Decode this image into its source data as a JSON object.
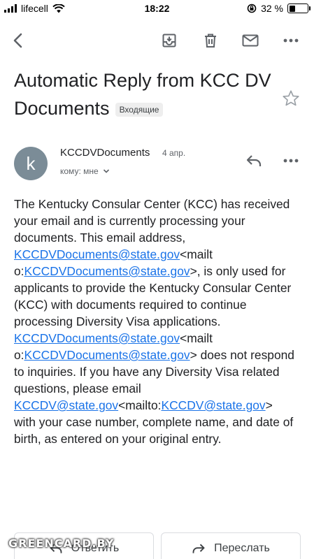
{
  "status_bar": {
    "carrier": "lifecell",
    "time": "18:22",
    "battery_percent": "32 %",
    "battery_level": 0.32
  },
  "toolbar": {
    "icons": [
      "back-icon",
      "archive-icon",
      "trash-icon",
      "mail-icon",
      "more-icon"
    ]
  },
  "email": {
    "subject": "Automatic Reply from KCC DV Documents",
    "label": "Входящие",
    "avatar_letter": "k",
    "avatar_color": "#7b8c97",
    "sender": "KCCDVDocuments",
    "date": "4 апр.",
    "recipient": "кому: мне",
    "body": {
      "p1": "The Kentucky Consular Center (KCC) has received your email and is currently processing your documents. This email address, ",
      "link1": "KCCDVDocuments@state.gov",
      "t1": "<mailt o:",
      "link2": "KCCDVDocuments@state.gov",
      "t2": ">, is only used for applicants to provide the Kentucky Consular Center (KCC) with documents required to continue processing Diversity Visa applications. ",
      "link3": "KCCDVDocuments@state.gov",
      "t3": "<mailt o:",
      "link4": "KCCDVDocuments@state.gov",
      "t4": "> does not respond to inquiries. If you have any Diversity Visa related questions, please email ",
      "link5": "KCCDV@state.gov",
      "t5": "<mailto:",
      "link6": "KCCDV@state.gov",
      "t6": "> with your case number, complete name, and date of birth, as entered on your original entry."
    },
    "link_color": "#1a73e8"
  },
  "actions": {
    "reply": "Ответить",
    "forward": "Переслать"
  },
  "watermark": "GREENCARD.BY"
}
